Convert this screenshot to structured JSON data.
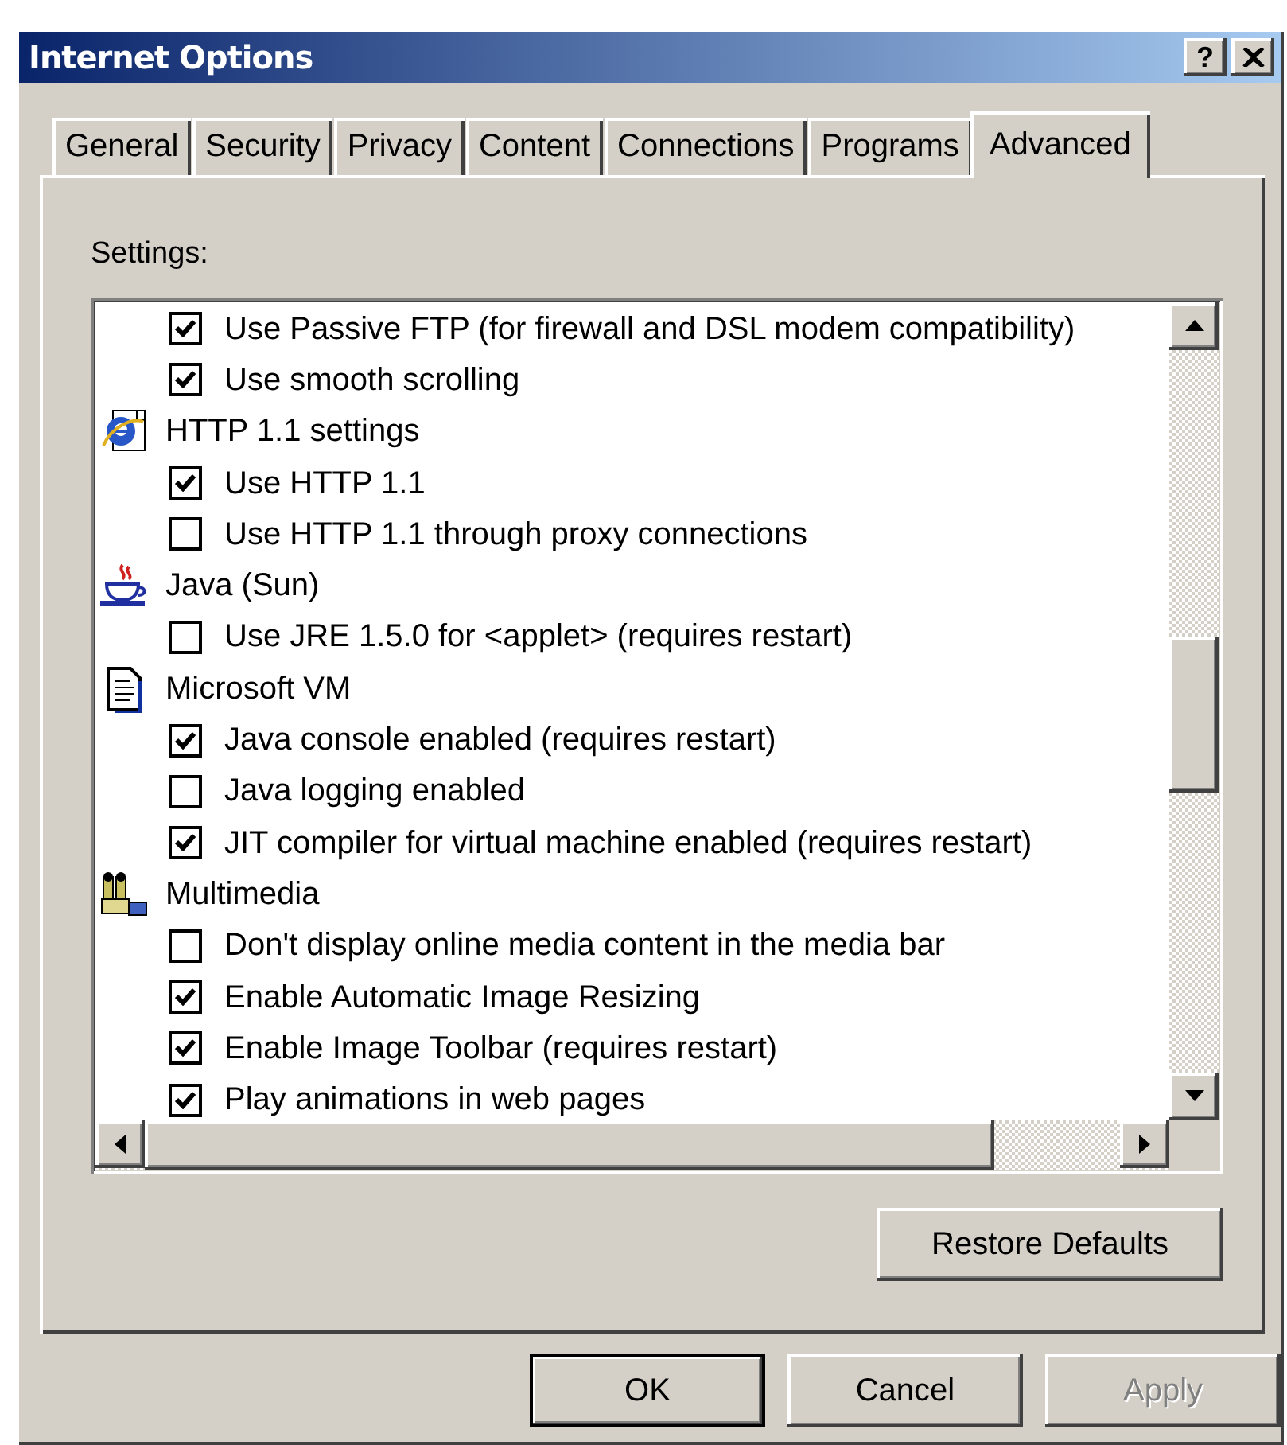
{
  "window": {
    "title": "Internet Options",
    "help_button": "?"
  },
  "tabs": [
    {
      "label": "General",
      "selected": false
    },
    {
      "label": "Security",
      "selected": false
    },
    {
      "label": "Privacy",
      "selected": false
    },
    {
      "label": "Content",
      "selected": false
    },
    {
      "label": "Connections",
      "selected": false
    },
    {
      "label": "Programs",
      "selected": false
    },
    {
      "label": "Advanced",
      "selected": true
    }
  ],
  "settings": {
    "label": "Settings:",
    "items": [
      {
        "kind": "checkbox",
        "label": "Use Passive FTP (for firewall and DSL modem compatibility)",
        "checked": true
      },
      {
        "kind": "checkbox",
        "label": "Use smooth scrolling",
        "checked": true
      },
      {
        "kind": "group",
        "label": "HTTP 1.1 settings"
      },
      {
        "kind": "checkbox",
        "label": "Use HTTP 1.1",
        "checked": true
      },
      {
        "kind": "checkbox",
        "label": "Use HTTP 1.1 through proxy connections",
        "checked": false
      },
      {
        "kind": "group",
        "label": "Java (Sun)"
      },
      {
        "kind": "checkbox",
        "label": "Use JRE 1.5.0 for <applet> (requires restart)",
        "checked": false
      },
      {
        "kind": "group",
        "label": "Microsoft VM"
      },
      {
        "kind": "checkbox",
        "label": "Java console enabled (requires restart)",
        "checked": true
      },
      {
        "kind": "checkbox",
        "label": "Java logging enabled",
        "checked": false
      },
      {
        "kind": "checkbox",
        "label": "JIT compiler for virtual machine enabled (requires restart)",
        "checked": true
      },
      {
        "kind": "group",
        "label": "Multimedia"
      },
      {
        "kind": "checkbox",
        "label": "Don't display online media content in the media bar",
        "checked": false
      },
      {
        "kind": "checkbox",
        "label": "Enable Automatic Image Resizing",
        "checked": true
      },
      {
        "kind": "checkbox",
        "label": "Enable Image Toolbar (requires restart)",
        "checked": true
      },
      {
        "kind": "checkbox",
        "label": "Play animations in web pages",
        "checked": true
      }
    ]
  },
  "restore_button": {
    "label": "Restore Defaults"
  },
  "buttons": [
    {
      "label": "OK",
      "disabled": false,
      "default": true
    },
    {
      "label": "Cancel",
      "disabled": false,
      "default": false
    },
    {
      "label": "Apply",
      "disabled": true,
      "default": false
    }
  ]
}
